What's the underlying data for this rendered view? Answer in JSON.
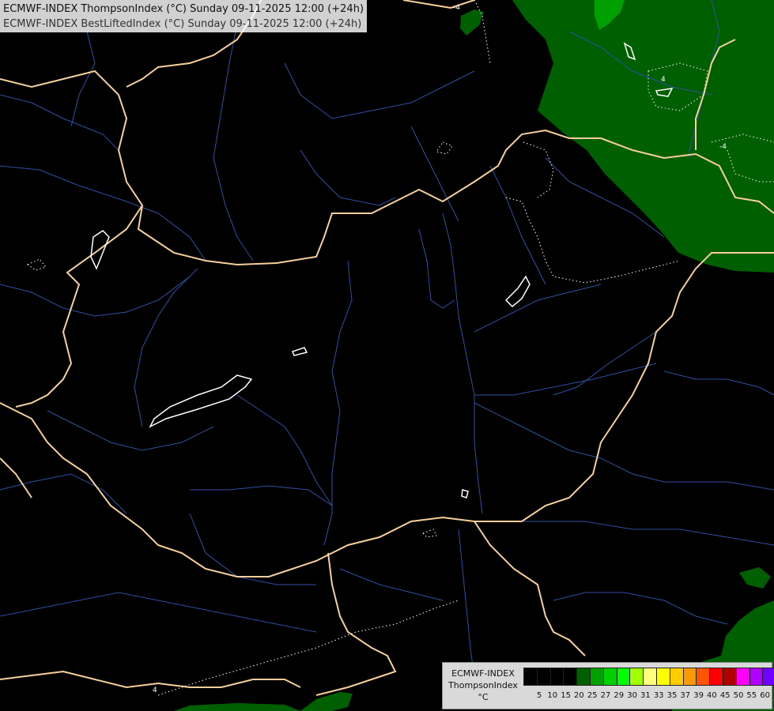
{
  "title": {
    "line1": "ECMWF-INDEX ThompsonIndex (°C) Sunday 09-11-2025 12:00 (+24h)",
    "line2": "ECMWF-INDEX BestLiftedIndex (°C) Sunday 09-11-2025 12:00 (+24h)"
  },
  "colors": {
    "background": "#000000",
    "borders": "#f6cf9a",
    "rivers": "#2f4fa5",
    "lakes": "#ffffff",
    "field_dark_green": "#005f00",
    "field_green": "#00aa00"
  },
  "contours": {
    "labels": [
      "4",
      "-4",
      "-4",
      "4"
    ]
  },
  "legend": {
    "line1": "ECMWF-INDEX",
    "line2": "ThompsonIndex",
    "unit": "°C",
    "colors": [
      "#000000",
      "#000000",
      "#000000",
      "#000000",
      "#005f00",
      "#00a000",
      "#00d000",
      "#00ff00",
      "#a0ff00",
      "#ffff80",
      "#ffff00",
      "#ffcc00",
      "#ff9900",
      "#ff5500",
      "#ff0000",
      "#b00000",
      "#ff00ff",
      "#b000ff",
      "#7000ff",
      "#0000ff"
    ],
    "ticks": [
      "5",
      "10",
      "15",
      "20",
      "25",
      "27",
      "29",
      "30",
      "31",
      "33",
      "35",
      "37",
      "39",
      "40",
      "45",
      "50",
      "55",
      "60"
    ]
  }
}
